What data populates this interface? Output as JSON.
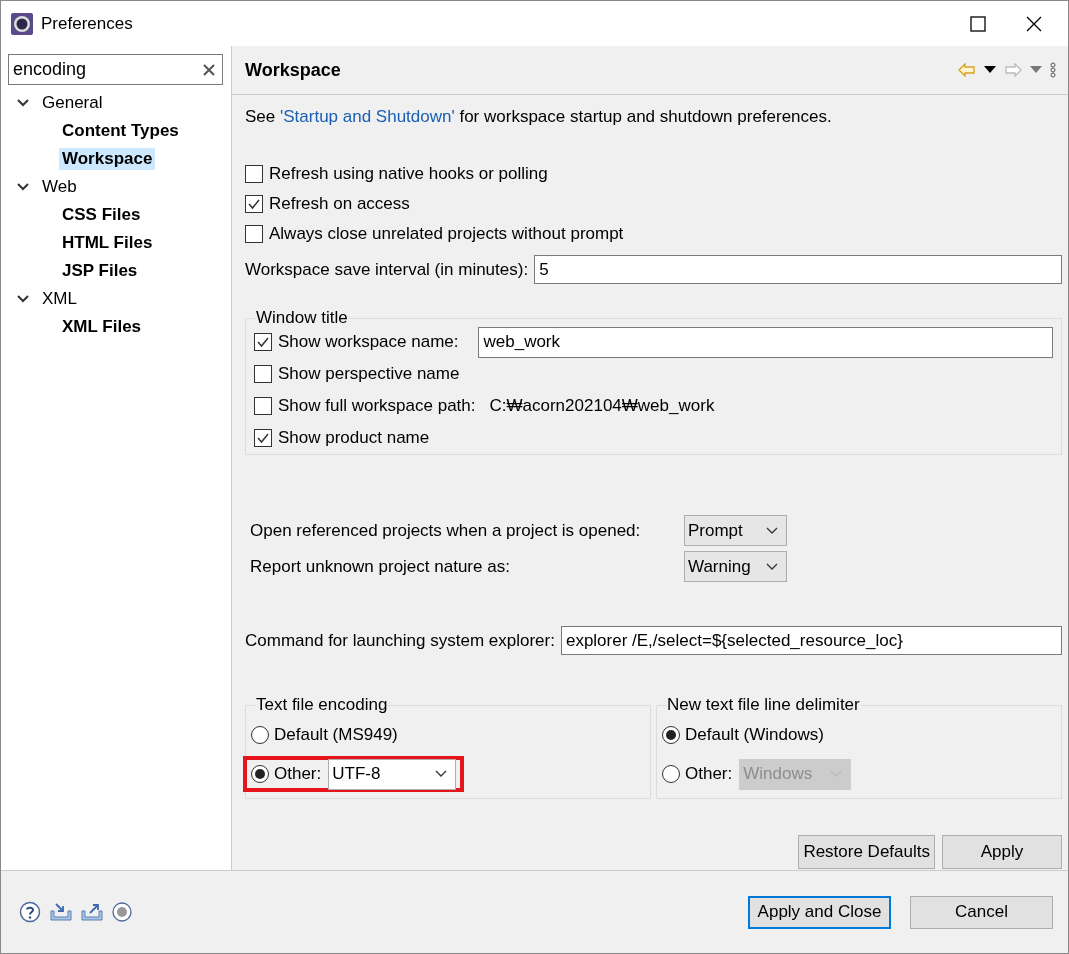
{
  "window": {
    "title": "Preferences"
  },
  "filter": {
    "value": "encoding"
  },
  "tree": [
    {
      "label": "General",
      "expanded": true,
      "children": [
        {
          "label": "Content Types",
          "selected": false
        },
        {
          "label": "Workspace",
          "selected": true
        }
      ]
    },
    {
      "label": "Web",
      "expanded": true,
      "children": [
        {
          "label": "CSS Files",
          "selected": false
        },
        {
          "label": "HTML Files",
          "selected": false
        },
        {
          "label": "JSP Files",
          "selected": false
        }
      ]
    },
    {
      "label": "XML",
      "expanded": true,
      "children": [
        {
          "label": "XML Files",
          "selected": false
        }
      ]
    }
  ],
  "page": {
    "title": "Workspace",
    "intro_before": "See ",
    "intro_link": "'Startup and Shutdown'",
    "intro_after": " for workspace startup and shutdown preferences."
  },
  "checkboxes": [
    {
      "label": "Refresh using native hooks or polling",
      "checked": false
    },
    {
      "label": "Refresh on access",
      "checked": true
    },
    {
      "label": "Always close unrelated projects without prompt",
      "checked": false
    }
  ],
  "save_interval": {
    "label": "Workspace save interval (in minutes):",
    "value": "5"
  },
  "window_title": {
    "title": "Window title",
    "items": [
      {
        "kind": "field",
        "label": "Show workspace name:",
        "checked": true,
        "value": "web_work"
      },
      {
        "kind": "plain",
        "label": "Show perspective name",
        "checked": false
      },
      {
        "kind": "path",
        "label": "Show full workspace path:",
        "checked": false,
        "path": "C:₩acorn202104₩web_work"
      },
      {
        "kind": "plain",
        "label": "Show product name",
        "checked": true
      }
    ]
  },
  "combos": [
    {
      "label": "Open referenced projects when a project is opened:",
      "value": "Prompt"
    },
    {
      "label": "Report unknown project nature as:",
      "value": "Warning"
    }
  ],
  "explorer": {
    "label": "Command for launching system explorer:",
    "value": "explorer /E,/select=${selected_resource_loc}"
  },
  "encoding_groups": [
    {
      "title": "Text file encoding",
      "options": [
        {
          "label": "Default (MS949)",
          "selected": false,
          "highlighted": false
        },
        {
          "label": "Other:",
          "selected": true,
          "highlighted": true,
          "combo": {
            "value": "UTF-8",
            "disabled": false
          }
        }
      ]
    },
    {
      "title": "New text file line delimiter",
      "options": [
        {
          "label": "Default (Windows)",
          "selected": true,
          "highlighted": false
        },
        {
          "label": "Other:",
          "selected": false,
          "highlighted": false,
          "combo": {
            "value": "Windows",
            "disabled": true
          }
        }
      ]
    }
  ],
  "page_buttons": [
    "Restore Defaults",
    "Apply"
  ],
  "footer_buttons": [
    {
      "label": "Apply and Close",
      "default": true
    },
    {
      "label": "Cancel",
      "default": false
    }
  ]
}
